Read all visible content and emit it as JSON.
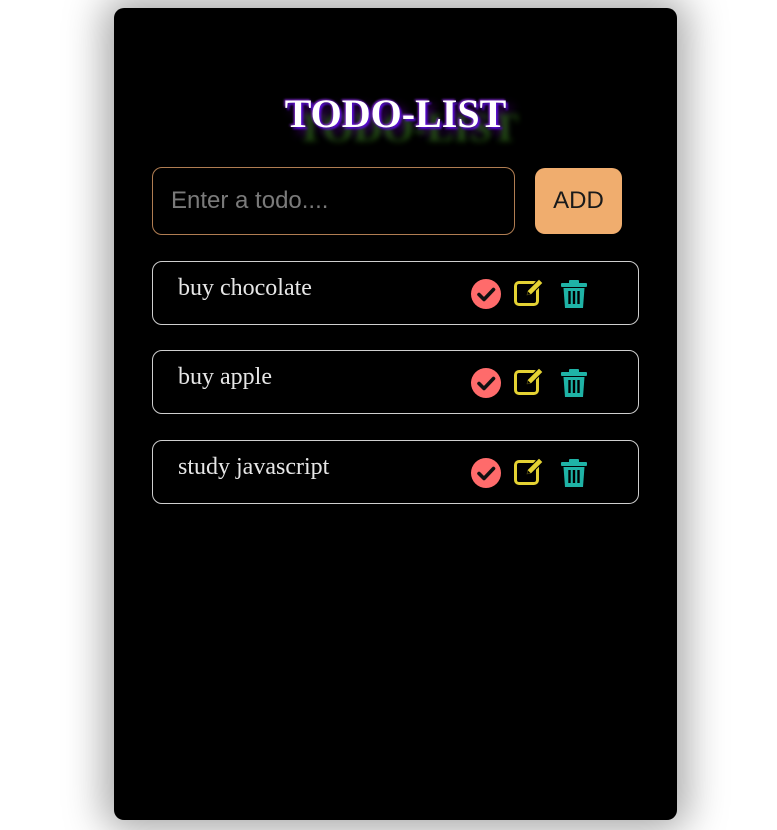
{
  "app": {
    "title": "TODO-LIST"
  },
  "form": {
    "placeholder": "Enter a todo....",
    "value": "",
    "add_label": "ADD"
  },
  "todos": [
    {
      "text": "buy chocolate"
    },
    {
      "text": "buy apple"
    },
    {
      "text": "study javascript"
    }
  ],
  "icons": {
    "complete": "check-circle-icon",
    "edit": "edit-icon",
    "delete": "trash-icon"
  },
  "colors": {
    "background": "#000000",
    "accent": "#f0ad6e",
    "check": "#ff6b6b",
    "edit": "#e4d233",
    "delete": "#1fb3a6"
  }
}
